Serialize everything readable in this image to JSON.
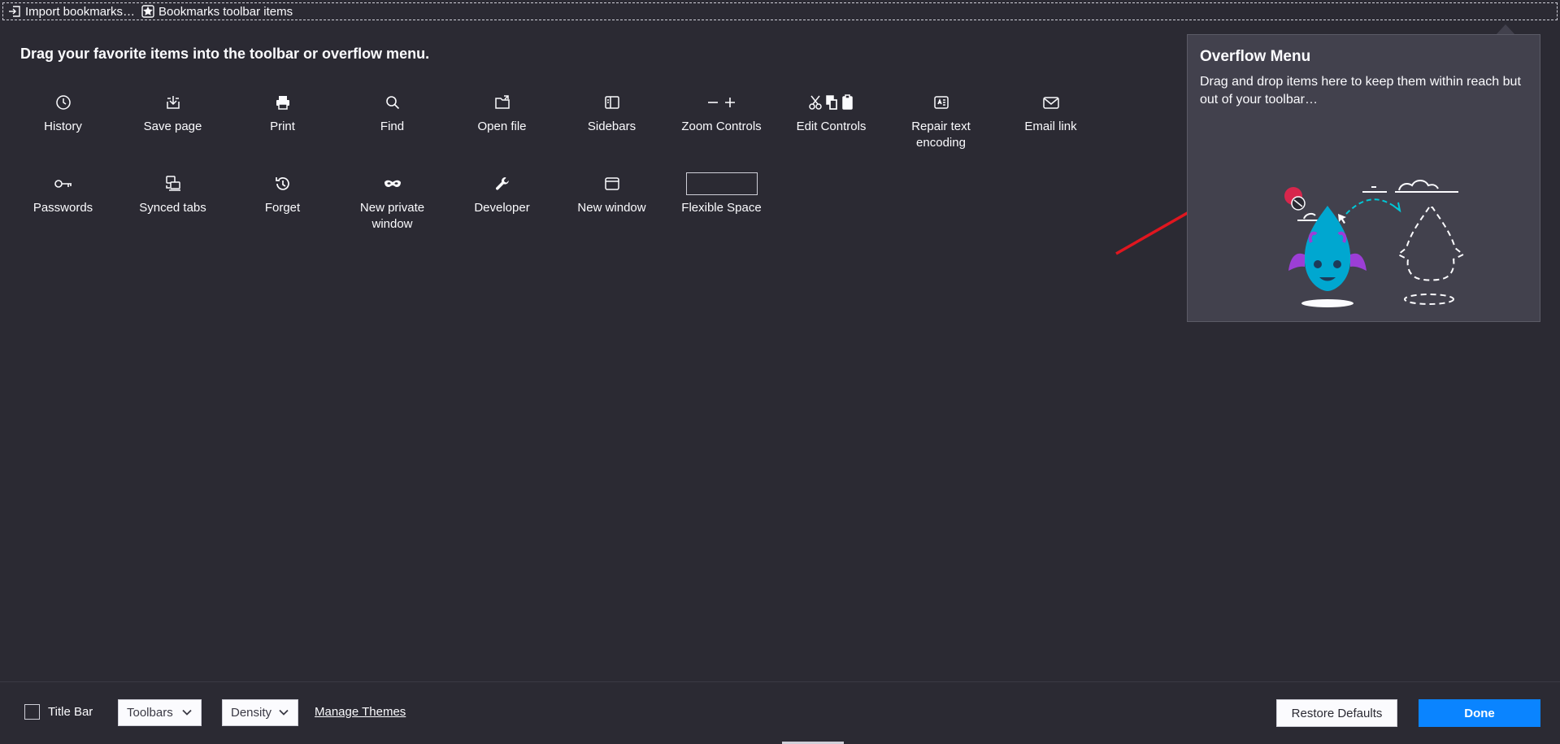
{
  "bookmarks_bar": {
    "import_label": "Import bookmarks…",
    "toolbar_items_label": "Bookmarks toolbar items"
  },
  "headline": "Drag your favorite items into the toolbar or overflow menu.",
  "palette": {
    "row1": [
      {
        "label": "History",
        "icon": "history-icon"
      },
      {
        "label": "Save page",
        "icon": "save-page-icon"
      },
      {
        "label": "Print",
        "icon": "print-icon"
      },
      {
        "label": "Find",
        "icon": "search-icon"
      },
      {
        "label": "Open file",
        "icon": "open-file-icon"
      },
      {
        "label": "Sidebars",
        "icon": "sidebars-icon"
      },
      {
        "label": "Zoom Controls",
        "icon": "zoom-controls-icon"
      },
      {
        "label": "Edit Controls",
        "icon": "edit-controls-icon"
      },
      {
        "label": "Repair text encoding",
        "icon": "text-encoding-icon"
      },
      {
        "label": "Email link",
        "icon": "email-icon"
      }
    ],
    "row2": [
      {
        "label": "Passwords",
        "icon": "key-icon"
      },
      {
        "label": "Synced tabs",
        "icon": "synced-tabs-icon"
      },
      {
        "label": "Forget",
        "icon": "forget-icon"
      },
      {
        "label": "New private window",
        "icon": "private-mask-icon"
      },
      {
        "label": "Developer",
        "icon": "wrench-icon"
      },
      {
        "label": "New window",
        "icon": "new-window-icon"
      },
      {
        "label": "Flexible Space",
        "icon": "flexible-space-box"
      }
    ]
  },
  "overflow": {
    "title": "Overflow Menu",
    "description": "Drag and drop items here to keep them within reach but out of your toolbar…"
  },
  "footer": {
    "title_bar_label": "Title Bar",
    "toolbars_label": "Toolbars",
    "density_label": "Density",
    "manage_themes_label": "Manage Themes",
    "restore_label": "Restore Defaults",
    "done_label": "Done"
  },
  "colors": {
    "background": "#2b2a33",
    "panel": "#42414d",
    "accent": "#0a84ff",
    "annotation_arrow": "#e0161f"
  }
}
